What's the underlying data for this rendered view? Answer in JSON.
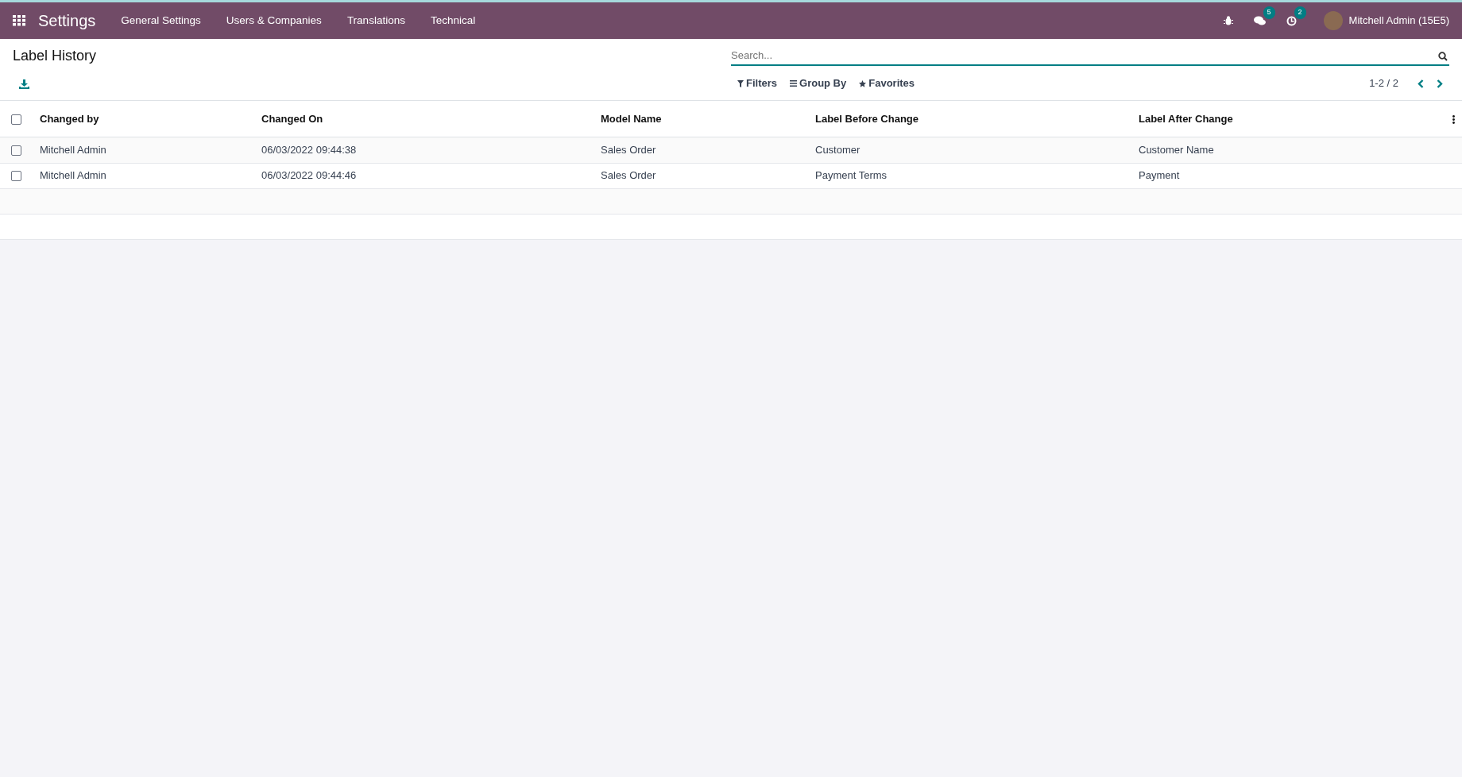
{
  "navbar": {
    "app_title": "Settings",
    "menu": [
      {
        "label": "General Settings"
      },
      {
        "label": "Users & Companies"
      },
      {
        "label": "Translations"
      },
      {
        "label": "Technical"
      }
    ],
    "messages_count": "5",
    "activities_count": "2",
    "user": "Mitchell Admin (15E5)"
  },
  "page": {
    "title": "Label History"
  },
  "search": {
    "placeholder": "Search..."
  },
  "filters": [
    {
      "kind": "filter",
      "label": "Filters"
    },
    {
      "kind": "group",
      "label": "Group By"
    },
    {
      "kind": "favorite",
      "label": "Favorites"
    }
  ],
  "pager": {
    "range": "1-2 / 2"
  },
  "table": {
    "select_all_checked": false,
    "columns": [
      "Changed by",
      "Changed On",
      "Model Name",
      "Label Before Change",
      "Label After Change"
    ],
    "rows": [
      {
        "checked": false,
        "cells": [
          "Mitchell Admin",
          "06/03/2022 09:44:38",
          "Sales Order",
          "Customer",
          "Customer Name"
        ]
      },
      {
        "checked": false,
        "cells": [
          "Mitchell Admin",
          "06/03/2022 09:44:46",
          "Sales Order",
          "Payment Terms",
          "Payment"
        ]
      }
    ]
  }
}
